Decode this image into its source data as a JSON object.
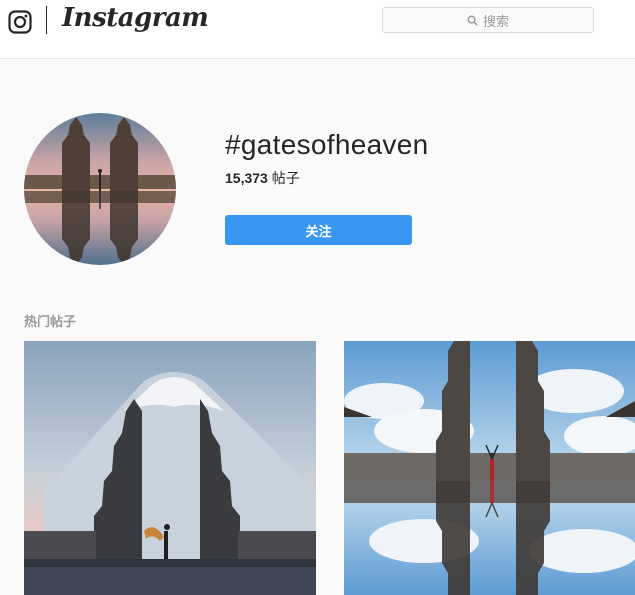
{
  "header": {
    "brand": "Instagram",
    "search": {
      "placeholder": "搜索"
    }
  },
  "profile": {
    "hashtag": "#gatesofheaven",
    "post_count": "15,373",
    "post_count_suffix": "帖子",
    "follow_label": "关注"
  },
  "top_posts": {
    "title": "热门帖子"
  },
  "colors": {
    "accent": "#3897f0",
    "background": "#fafafa",
    "text": "#262626",
    "muted": "#999999"
  },
  "icons": [
    "instagram-camera-icon",
    "search-icon"
  ]
}
